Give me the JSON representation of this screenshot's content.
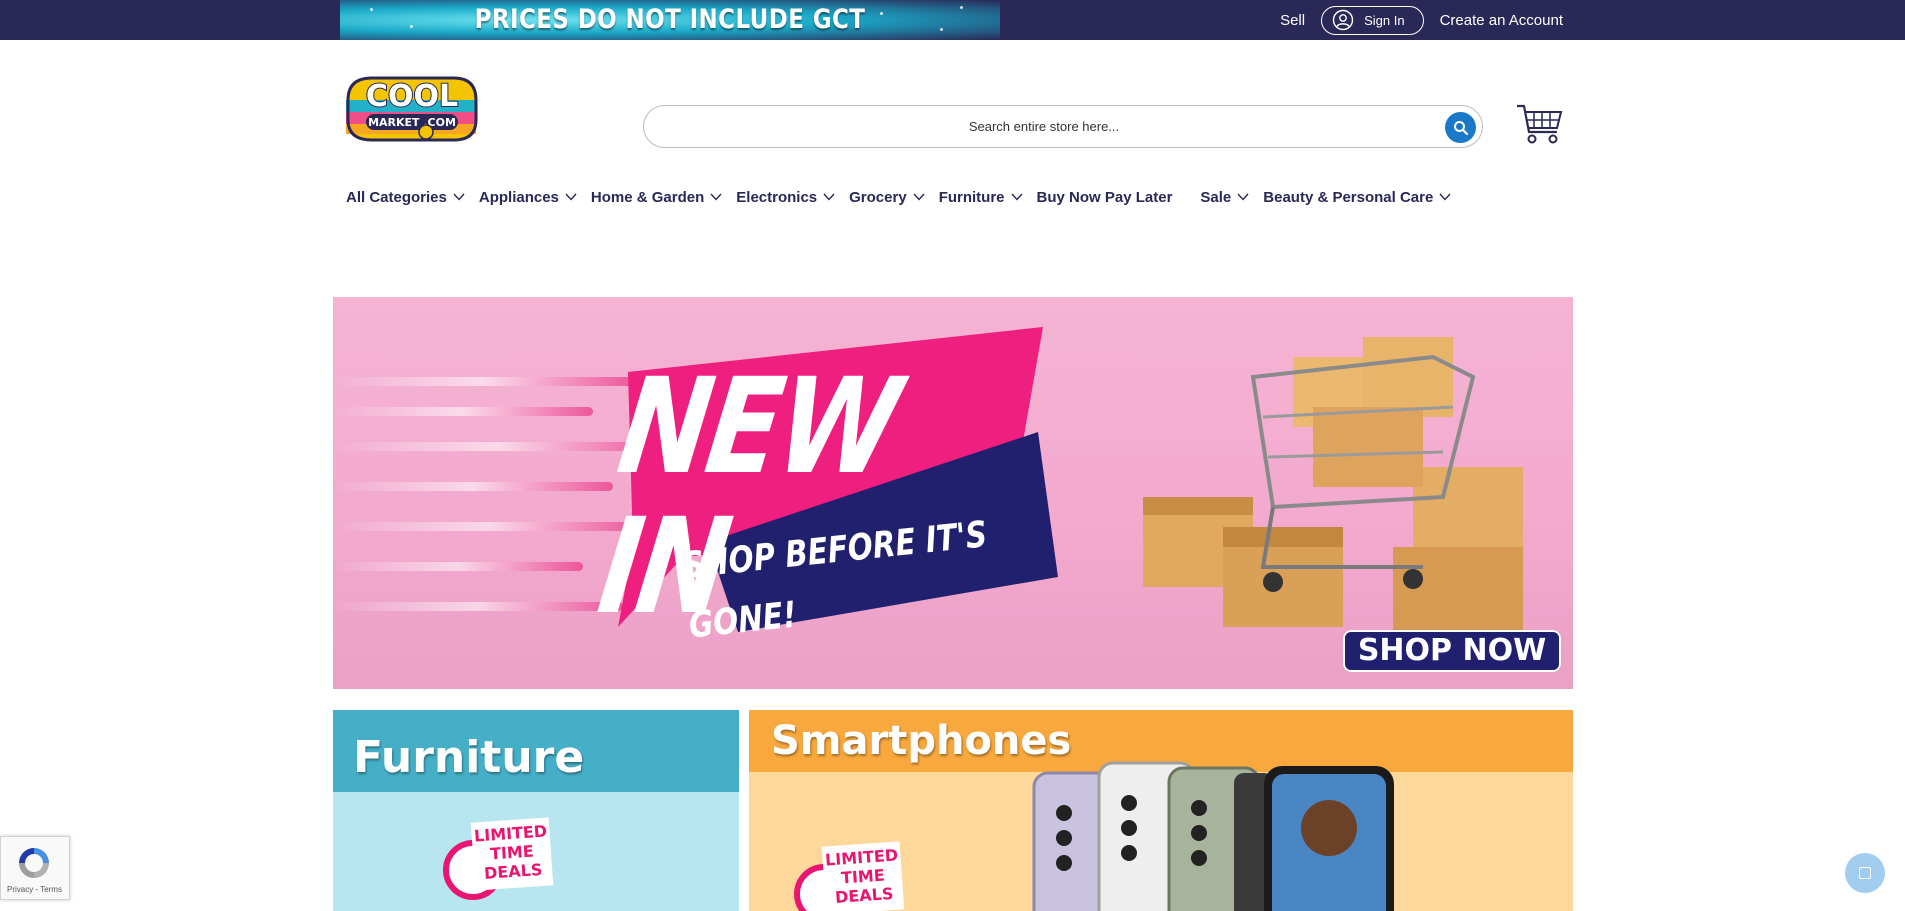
{
  "topbar": {
    "promo_text": "PRICES DO NOT INCLUDE GCT",
    "sell_label": "Sell",
    "signin_label": "Sign In",
    "create_account_label": "Create an Account"
  },
  "header": {
    "logo_alt": "COOL MARKET .COM",
    "search_placeholder": "Search entire store here..."
  },
  "nav": {
    "items": [
      {
        "label": "All Categories"
      },
      {
        "label": "Appliances"
      },
      {
        "label": "Home & Garden"
      },
      {
        "label": "Electronics"
      },
      {
        "label": "Grocery"
      },
      {
        "label": "Furniture"
      },
      {
        "label": "Buy Now Pay Later"
      },
      {
        "label": "Sale"
      },
      {
        "label": "Beauty & Personal Care"
      }
    ]
  },
  "hero": {
    "headline": "NEW IN",
    "tagline": "SHOP BEFORE IT'S GONE!",
    "cta": "SHOP NOW"
  },
  "tiles": {
    "furniture": {
      "title": "Furniture",
      "badge_line1": "LIMITED",
      "badge_line2": "TIME",
      "badge_line3": "DEALS"
    },
    "smartphones": {
      "title": "Smartphones",
      "badge_line1": "LIMITED",
      "badge_line2": "TIME",
      "badge_line3": "DEALS"
    }
  },
  "recaptcha": {
    "text": "Privacy - Terms"
  },
  "colors": {
    "topbar": "#2a2856",
    "nav_text": "#2a2856",
    "search_button": "#1978c8",
    "hero_pink": "#ee1f7f",
    "hero_navy": "#21206e"
  }
}
